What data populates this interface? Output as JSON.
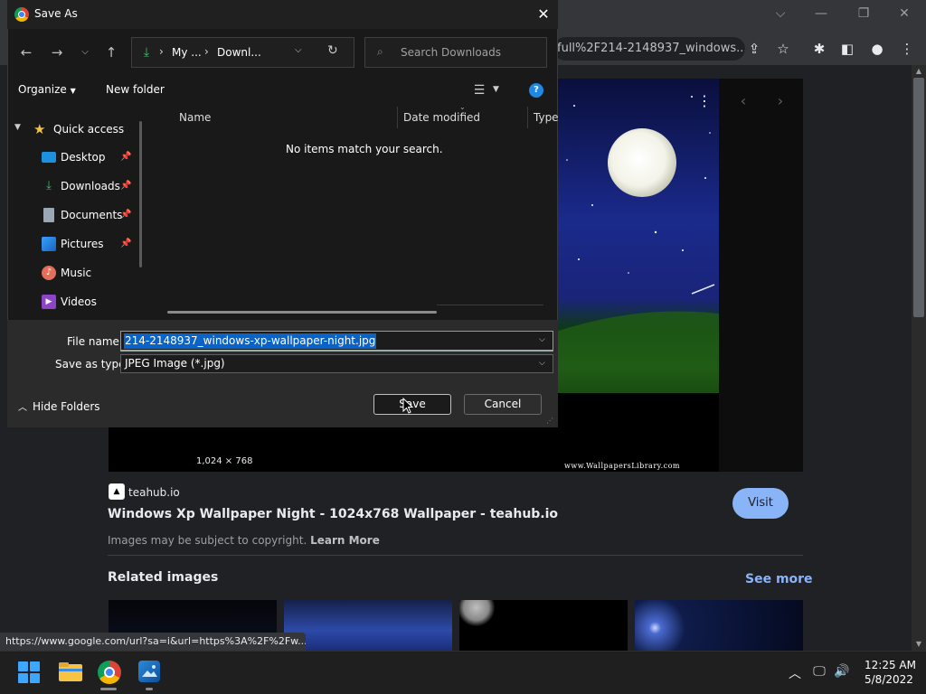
{
  "browser": {
    "omnibox_url": "full%2F214-2148937_windows...",
    "status_url": "https://www.google.com/url?sa=i&url=https%3A%2F%2Fw..."
  },
  "result": {
    "dims": "1,024 × 768",
    "watermark": "www.WallpapersLibrary.com",
    "site_name": "teahub.io",
    "title": "Windows Xp Wallpaper Night - 1024x768 Wallpaper - teahub.io",
    "copyright": "Images may be subject to copyright.",
    "learn_more": "Learn More",
    "visit_label": "Visit",
    "related_title": "Related images",
    "see_more": "See more"
  },
  "dialog": {
    "title": "Save As",
    "breadcrumb": [
      "My ...",
      "Downl..."
    ],
    "search_placeholder": "Search Downloads",
    "organize": "Organize",
    "new_folder": "New folder",
    "help": "?",
    "quick_access": "Quick access",
    "nav_items": [
      {
        "label": "Desktop",
        "icon": "desktop-icon",
        "pinned": true
      },
      {
        "label": "Downloads",
        "icon": "downloads-icon",
        "pinned": true
      },
      {
        "label": "Documents",
        "icon": "documents-icon",
        "pinned": true
      },
      {
        "label": "Pictures",
        "icon": "pictures-icon",
        "pinned": true
      },
      {
        "label": "Music",
        "icon": "music-icon",
        "pinned": false
      },
      {
        "label": "Videos",
        "icon": "videos-icon",
        "pinned": false
      }
    ],
    "columns": [
      "Name",
      "Date modified",
      "Type"
    ],
    "empty_message": "No items match your search.",
    "file_name_label": "File name:",
    "file_name_value": "214-2148937_windows-xp-wallpaper-night.jpg",
    "save_type_label": "Save as type:",
    "save_type_value": "JPEG Image (*.jpg)",
    "hide_folders": "Hide Folders",
    "save_label": "Save",
    "cancel_label": "Cancel"
  },
  "taskbar": {
    "time": "12:25 AM",
    "date": "5/8/2022"
  },
  "colors": {
    "accent": "#8ab4f8",
    "selection": "#0a64c8",
    "dialog_bg": "#191919"
  }
}
